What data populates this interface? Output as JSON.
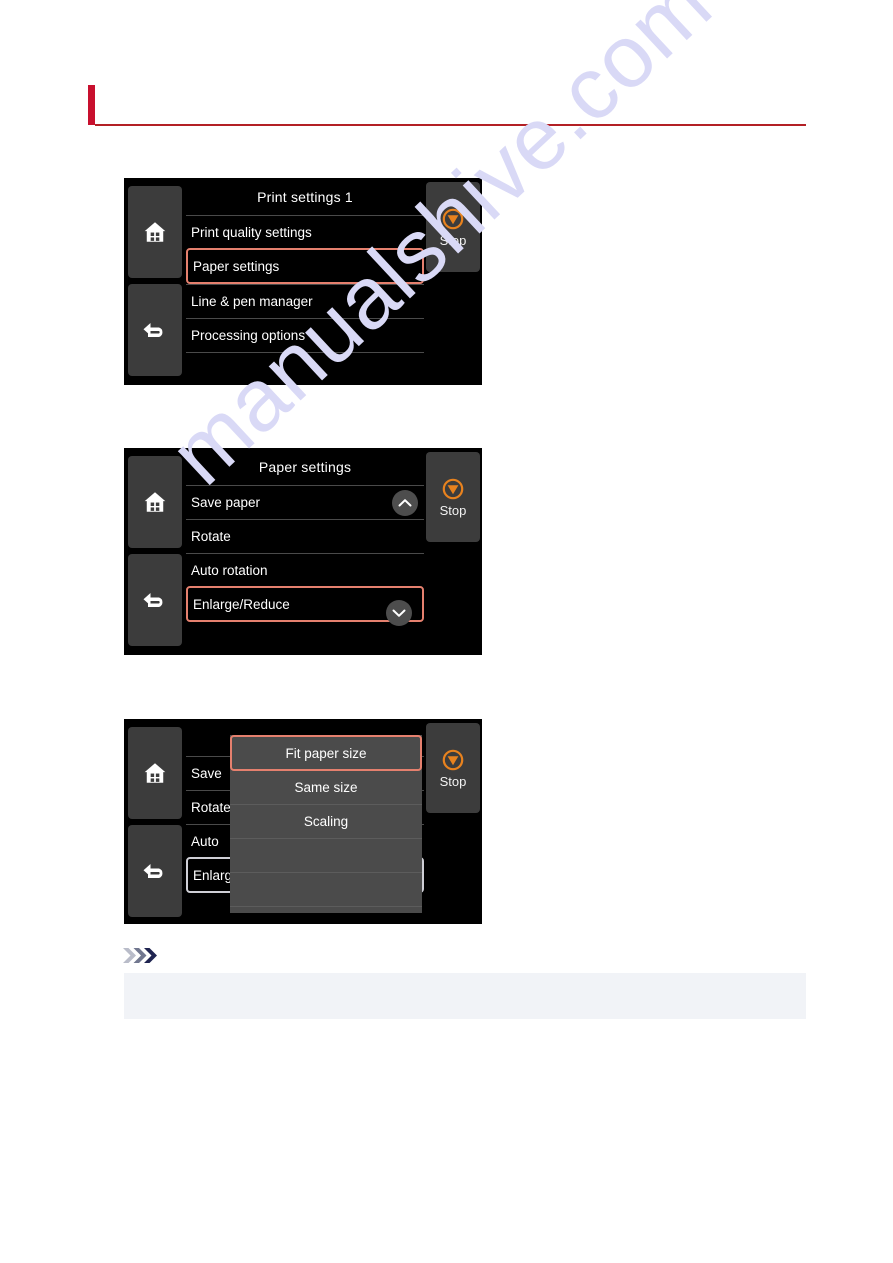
{
  "header": {
    "title": "",
    "accent_color": "#c8102e",
    "rule_color": "#b32025"
  },
  "watermark": {
    "text": "manualshive.com",
    "color": "#d9d9f6"
  },
  "colors": {
    "lcd_background": "#000000",
    "hardware_key": "#3c3c3c",
    "selection_border": "#e5806e",
    "dialog_background": "#4b4b4b",
    "stop_icon": "#e8821e",
    "note_box": "#f1f3f7"
  },
  "panels": [
    {
      "id": "panel-print-settings-1",
      "menu_title": "Print settings 1",
      "stop_label": "Stop",
      "rows": [
        {
          "label": "Print quality settings",
          "selected": false,
          "chevron": ""
        },
        {
          "label": "Paper settings",
          "selected": true,
          "chevron": ""
        },
        {
          "label": "Line & pen manager",
          "selected": false,
          "chevron": ""
        },
        {
          "label": "Processing options",
          "selected": false,
          "chevron": ""
        },
        {
          "label": "",
          "selected": false,
          "chevron": ""
        }
      ]
    },
    {
      "id": "panel-paper-settings",
      "menu_title": "Paper settings",
      "stop_label": "Stop",
      "rows": [
        {
          "label": "Save paper",
          "selected": false,
          "chevron": "up"
        },
        {
          "label": "Rotate",
          "selected": false,
          "chevron": ""
        },
        {
          "label": "Auto rotation",
          "selected": false,
          "chevron": ""
        },
        {
          "label": "Enlarge/Reduce",
          "selected": true,
          "chevron": "down"
        }
      ]
    },
    {
      "id": "panel-enlarge-reduce-dialog",
      "menu_title": "",
      "stop_label": "Stop",
      "rows": [
        {
          "label": "Save",
          "selected": false,
          "chevron": ""
        },
        {
          "label": "Rotate",
          "selected": false,
          "chevron": ""
        },
        {
          "label": "Auto",
          "selected": false,
          "chevron": ""
        },
        {
          "label": "Enlarge",
          "selected": false,
          "dim_selected": true,
          "chevron": ""
        }
      ],
      "dialog": {
        "items": [
          {
            "label": "Fit paper size",
            "selected": true
          },
          {
            "label": "Same size",
            "selected": false
          },
          {
            "label": "Scaling",
            "selected": false
          },
          {
            "label": "",
            "selected": false
          },
          {
            "label": "",
            "selected": false
          }
        ]
      }
    }
  ],
  "note": {
    "title": "",
    "body": ""
  },
  "icons": {
    "home": "home-icon",
    "back": "back-arrow-icon",
    "stop": "stop-icon",
    "chevron_up": "chevron-up-icon",
    "chevron_down": "chevron-down-icon",
    "note": "triple-chevron-icon"
  }
}
